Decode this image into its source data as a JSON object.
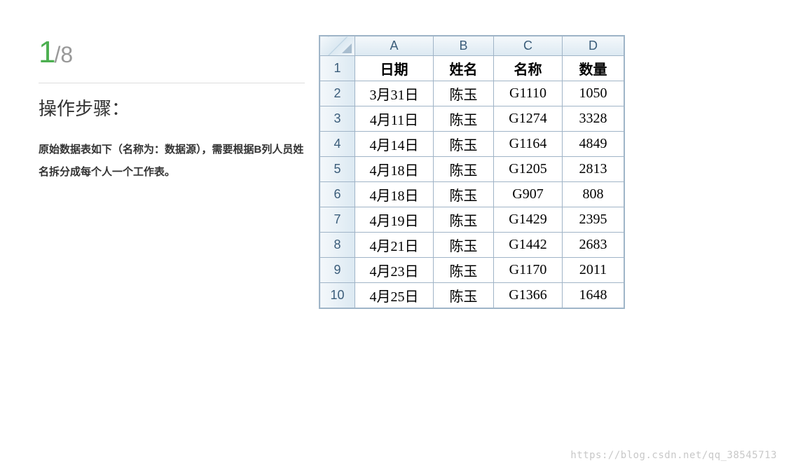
{
  "step": {
    "current": "1",
    "total": "/8"
  },
  "title": "操作步骤：",
  "description": "原始数据表如下（名称为：数据源），需要根据B列人员姓名拆分成每个人一个工作表。",
  "excel": {
    "columns": [
      "A",
      "B",
      "C",
      "D"
    ],
    "rowNumbers": [
      "1",
      "2",
      "3",
      "4",
      "5",
      "6",
      "7",
      "8",
      "9",
      "10"
    ],
    "headers": [
      "日期",
      "姓名",
      "名称",
      "数量"
    ],
    "rows": [
      [
        "3月31日",
        "陈玉",
        "G1110",
        "1050"
      ],
      [
        "4月11日",
        "陈玉",
        "G1274",
        "3328"
      ],
      [
        "4月14日",
        "陈玉",
        "G1164",
        "4849"
      ],
      [
        "4月18日",
        "陈玉",
        "G1205",
        "2813"
      ],
      [
        "4月18日",
        "陈玉",
        "G907",
        "808"
      ],
      [
        "4月19日",
        "陈玉",
        "G1429",
        "2395"
      ],
      [
        "4月21日",
        "陈玉",
        "G1442",
        "2683"
      ],
      [
        "4月23日",
        "陈玉",
        "G1170",
        "2011"
      ],
      [
        "4月25日",
        "陈玉",
        "G1366",
        "1648"
      ]
    ]
  },
  "watermark": "https://blog.csdn.net/qq_38545713",
  "chart_data": {
    "type": "table",
    "title": "数据源",
    "columns": [
      "日期",
      "姓名",
      "名称",
      "数量"
    ],
    "rows": [
      [
        "3月31日",
        "陈玉",
        "G1110",
        1050
      ],
      [
        "4月11日",
        "陈玉",
        "G1274",
        3328
      ],
      [
        "4月14日",
        "陈玉",
        "G1164",
        4849
      ],
      [
        "4月18日",
        "陈玉",
        "G1205",
        2813
      ],
      [
        "4月18日",
        "陈玉",
        "G907",
        808
      ],
      [
        "4月19日",
        "陈玉",
        "G1429",
        2395
      ],
      [
        "4月21日",
        "陈玉",
        "G1442",
        2683
      ],
      [
        "4月23日",
        "陈玉",
        "G1170",
        2011
      ],
      [
        "4月25日",
        "陈玉",
        "G1366",
        1648
      ]
    ]
  }
}
